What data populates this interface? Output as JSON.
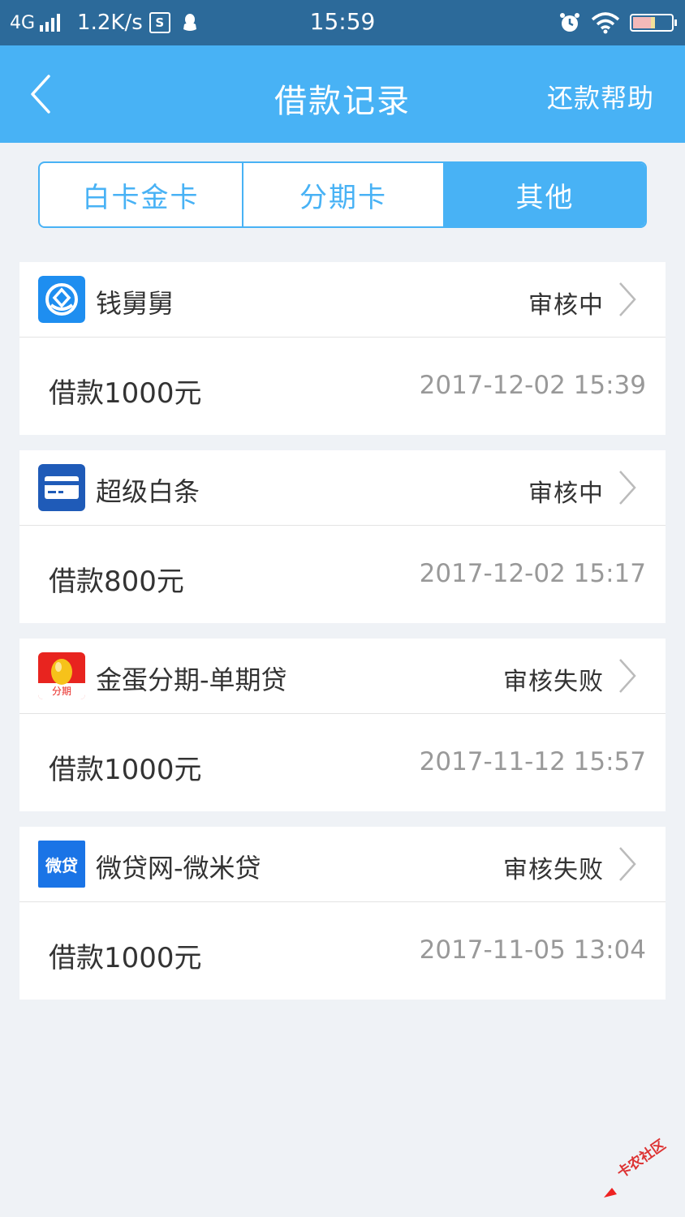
{
  "status_bar": {
    "network": "4G",
    "speed": "1.2K/s",
    "s_badge": "S",
    "time": "15:59"
  },
  "header": {
    "title": "借款记录",
    "help": "还款帮助"
  },
  "tabs": [
    {
      "label": "白卡金卡",
      "active": false
    },
    {
      "label": "分期卡",
      "active": false
    },
    {
      "label": "其他",
      "active": true
    }
  ],
  "records": [
    {
      "app": "钱舅舅",
      "status": "审核中",
      "amount": "借款1000元",
      "time": "2017-12-02 15:39"
    },
    {
      "app": "超级白条",
      "status": "审核中",
      "amount": "借款800元",
      "time": "2017-12-02 15:17"
    },
    {
      "app": "金蛋分期-单期贷",
      "status": "审核失败",
      "amount": "借款1000元",
      "time": "2017-11-12 15:57",
      "logo_text": "分期"
    },
    {
      "app": "微贷网-微米贷",
      "status": "审核失败",
      "amount": "借款1000元",
      "time": "2017-11-05 13:04",
      "logo_text": "微贷"
    }
  ],
  "watermark": {
    "text": "卡农社区"
  },
  "colors": {
    "accent": "#48b2f5",
    "status_bar": "#2c6a9a",
    "background": "#eff2f6"
  }
}
